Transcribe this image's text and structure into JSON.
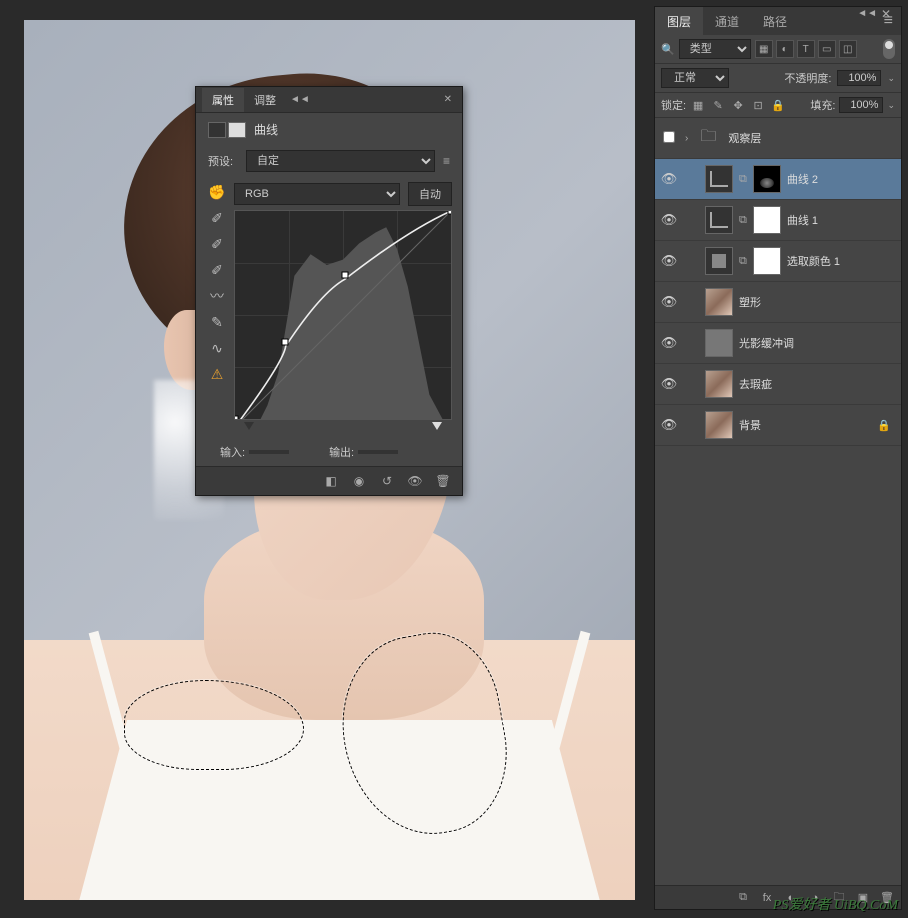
{
  "canvas": {
    "watermark": "PS爱好者 UiBQ.CoM"
  },
  "properties_panel": {
    "tabs": {
      "properties": "属性",
      "adjustments": "调整"
    },
    "title": "曲线",
    "preset_label": "预设:",
    "preset_value": "自定",
    "channel_value": "RGB",
    "auto_button": "自动",
    "input_label": "输入:",
    "output_label": "输出:",
    "input_value": "",
    "output_value": "",
    "tools": [
      "hand-icon",
      "eyedropper-white",
      "eyedropper-gray",
      "eyedropper-black",
      "curve-icon",
      "pencil-icon",
      "smooth-icon",
      "histogram-icon"
    ],
    "footer_icons": [
      "clip-icon",
      "link-icon",
      "reset-icon",
      "eye-icon",
      "trash-icon"
    ]
  },
  "layers_panel": {
    "tabs": {
      "layers": "图层",
      "channels": "通道",
      "paths": "路径"
    },
    "filter_label": "类型",
    "filter_search_icon": "🔍",
    "filter_icons": [
      "image-filter",
      "adjust-filter",
      "type-filter",
      "shape-filter",
      "smart-filter"
    ],
    "blend_mode": "正常",
    "opacity_label": "不透明度:",
    "opacity_value": "100%",
    "lock_label": "锁定:",
    "fill_label": "填充:",
    "fill_value": "100%",
    "lock_icons": [
      "image-lock",
      "brush-lock",
      "move-lock",
      "artboard-lock",
      "all-lock"
    ],
    "layers": [
      {
        "type": "group",
        "name": "观察层",
        "visible": false,
        "expanded": false
      },
      {
        "type": "adj",
        "name": "曲线 2",
        "visible": true,
        "selected": true,
        "icon": "curves",
        "mask": "dark",
        "linked": true
      },
      {
        "type": "adj",
        "name": "曲线 1",
        "visible": true,
        "icon": "curves",
        "mask": "white",
        "linked": true
      },
      {
        "type": "adj",
        "name": "选取颜色 1",
        "visible": true,
        "icon": "selcolor",
        "mask": "white",
        "linked": true
      },
      {
        "type": "photo",
        "name": "塑形",
        "visible": true
      },
      {
        "type": "photo",
        "name": "光影缓冲调",
        "visible": true,
        "dim": true
      },
      {
        "type": "photo",
        "name": "去瑕疵",
        "visible": true
      },
      {
        "type": "photo",
        "name": "背景",
        "visible": true,
        "locked": true
      }
    ],
    "footer_icons": [
      "link-icon",
      "fx-icon",
      "mask-icon",
      "fill-adj-icon",
      "group-icon",
      "new-icon",
      "trash-icon"
    ]
  },
  "chart_data": {
    "type": "line",
    "title": "曲线",
    "xlabel": "输入",
    "ylabel": "输出",
    "xlim": [
      0,
      255
    ],
    "ylim": [
      0,
      255
    ],
    "series": [
      {
        "name": "RGB",
        "x": [
          0,
          60,
          130,
          255
        ],
        "y": [
          0,
          95,
          175,
          255
        ]
      }
    ],
    "histogram_note": "dark-weighted histogram with mass between ~40 and ~220"
  }
}
